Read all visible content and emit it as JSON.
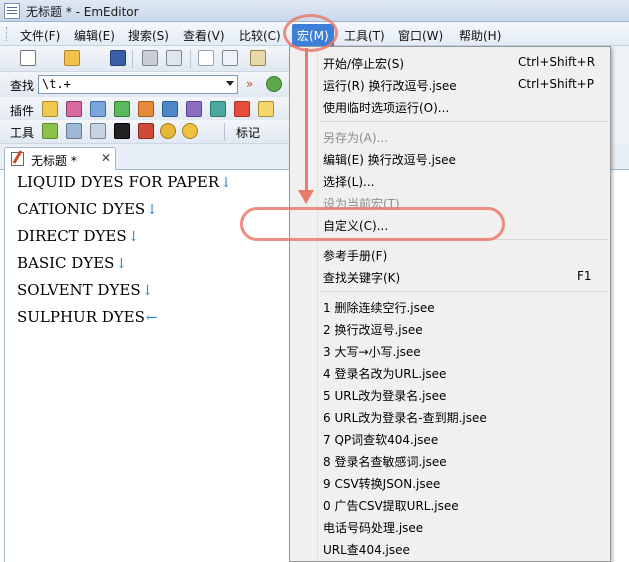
{
  "window": {
    "title": "无标题 * - EmEditor"
  },
  "menubar": {
    "items": [
      {
        "label": "文件(F)"
      },
      {
        "label": "编辑(E)"
      },
      {
        "label": "搜索(S)"
      },
      {
        "label": "查看(V)"
      },
      {
        "label": "比较(C)"
      },
      {
        "label": "宏(M)"
      },
      {
        "label": "工具(T)"
      },
      {
        "label": "窗口(W)"
      },
      {
        "label": "帮助(H)"
      }
    ]
  },
  "find_bar": {
    "label": "查找",
    "value": "\\t.+",
    "more": "»"
  },
  "plugins_bar": {
    "label": "插件"
  },
  "tools_bar": {
    "label": "工具",
    "marks_label": "标记"
  },
  "tab": {
    "title": "无标题 *",
    "close": "✕"
  },
  "editor": {
    "eol_newline": "↓",
    "eol_end": "←",
    "lines": [
      {
        "text": "LIQUID DYES FOR PAPER"
      },
      {
        "text": "CATIONIC DYES"
      },
      {
        "text": "DIRECT DYES"
      },
      {
        "text": "BASIC DYES"
      },
      {
        "text": "SOLVENT DYES"
      },
      {
        "text": "SULPHUR DYES"
      }
    ]
  },
  "macro_menu": {
    "items": [
      {
        "label": "开始/停止宏(S)",
        "shortcut": "Ctrl+Shift+R"
      },
      {
        "label": "运行(R) 换行改逗号.jsee",
        "shortcut": "Ctrl+Shift+P"
      },
      {
        "label": "使用临时选项运行(O)..."
      },
      {
        "label": "另存为(A)..."
      },
      {
        "label": "编辑(E) 换行改逗号.jsee"
      },
      {
        "label": "选择(L)..."
      },
      {
        "label": "设为当前宏(T)"
      },
      {
        "label": "自定义(C)..."
      },
      {
        "label": "参考手册(F)"
      },
      {
        "label": "查找关键字(K)",
        "shortcut": "F1"
      },
      {
        "label": "1 删除连续空行.jsee"
      },
      {
        "label": "2 换行改逗号.jsee"
      },
      {
        "label": "3 大写→小写.jsee"
      },
      {
        "label": "4 登录名改为URL.jsee"
      },
      {
        "label": "5 URL改为登录名.jsee"
      },
      {
        "label": "6 URL改为登录名-查到期.jsee"
      },
      {
        "label": "7 QP词查软404.jsee"
      },
      {
        "label": "8 登录名查敏感词.jsee"
      },
      {
        "label": "9 CSV转换JSON.jsee"
      },
      {
        "label": "0 广告CSV提取URL.jsee"
      },
      {
        "label": "电话号码处理.jsee"
      },
      {
        "label": "URL查404.jsee"
      }
    ]
  },
  "colors": {
    "menu_active": "#3d7fd6",
    "annotation": "#e97a6c",
    "eol_marks": "#2e8ad8"
  }
}
